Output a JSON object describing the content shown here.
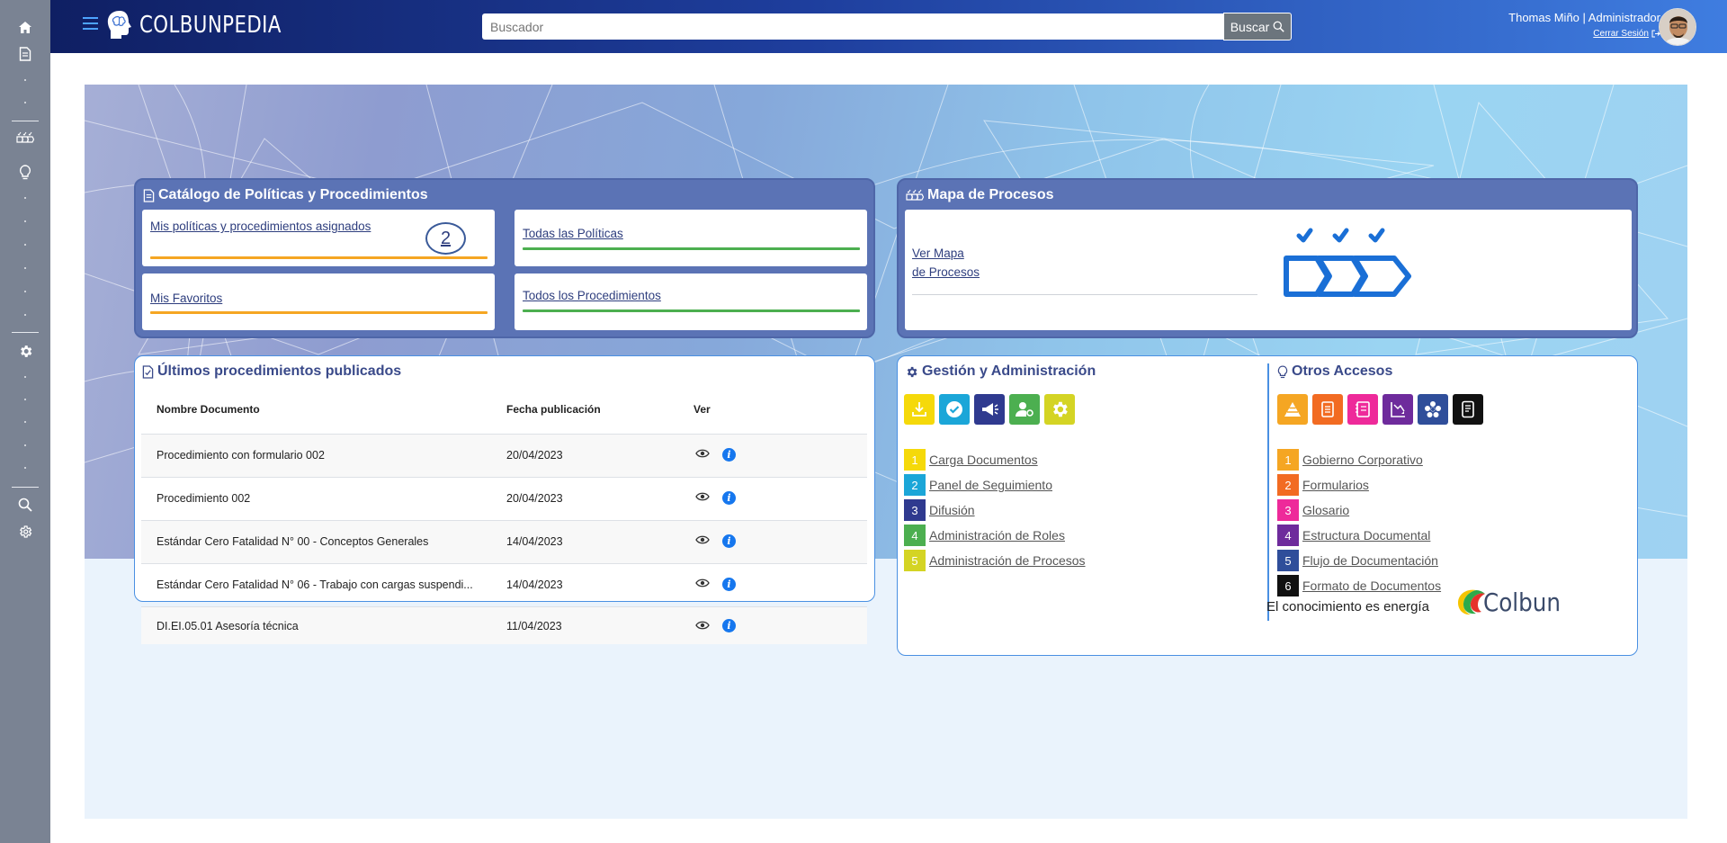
{
  "app": {
    "brand": "COLBUNPEDIA"
  },
  "header": {
    "search_placeholder": "Buscador",
    "search_button": "Buscar",
    "user_name": "Thomas Miño | Administrador",
    "logout_label": "Cerrar Sesión"
  },
  "catalog": {
    "title": "Catálogo de Políticas y Procedimientos",
    "assigned_label": "Mis políticas y procedimientos asignados",
    "assigned_count": "2",
    "favorites_label": "Mis Favoritos",
    "all_policies_label": "Todas las Políticas",
    "all_procedures_label": "Todos los Procedimientos"
  },
  "process_map": {
    "title": "Mapa de Procesos",
    "link_line1": "Ver Mapa",
    "link_line2": "de Procesos"
  },
  "latest": {
    "title": "Últimos procedimientos publicados",
    "columns": [
      "Nombre Documento",
      "Fecha publicación",
      "Ver"
    ],
    "rows": [
      {
        "name": "Procedimiento con formulario 002",
        "date": "20/04/2023"
      },
      {
        "name": "Procedimiento 002",
        "date": "20/04/2023"
      },
      {
        "name": "Estándar Cero Fatalidad N° 00 - Conceptos Generales",
        "date": "14/04/2023"
      },
      {
        "name": "Estándar Cero Fatalidad N° 06 - Trabajo con cargas suspendi...",
        "date": "14/04/2023"
      },
      {
        "name": "DI.EI.05.01 Asesoría técnica",
        "date": "11/04/2023"
      }
    ]
  },
  "management": {
    "title": "Gestión y Administración",
    "tiles": [
      {
        "icon": "download-icon",
        "color": "#f5d90a"
      },
      {
        "icon": "check-circle-icon",
        "color": "#1ba6d8"
      },
      {
        "icon": "megaphone-icon",
        "color": "#2f3a8f"
      },
      {
        "icon": "user-gear-icon",
        "color": "#4caf50"
      },
      {
        "icon": "gear-icon",
        "color": "#d4d424"
      }
    ],
    "items": [
      {
        "num": "1",
        "label": "Carga Documentos",
        "color": "#f5d90a"
      },
      {
        "num": "2",
        "label": "Panel de Seguimiento",
        "color": "#1ba6d8"
      },
      {
        "num": "3",
        "label": "Difusión",
        "color": "#2f3a8f"
      },
      {
        "num": "4",
        "label": "Administración de Roles",
        "color": "#4caf50"
      },
      {
        "num": "5",
        "label": "Administración de Procesos",
        "color": "#d4d424"
      }
    ]
  },
  "other": {
    "title": "Otros Accesos",
    "tiles": [
      {
        "icon": "pyramid-icon",
        "color": "#f5a623"
      },
      {
        "icon": "form-icon",
        "color": "#f26b22"
      },
      {
        "icon": "glossary-icon",
        "color": "#ee2a9a"
      },
      {
        "icon": "structure-icon",
        "color": "#6e2b9c"
      },
      {
        "icon": "flow-icon",
        "color": "#2f4e9a"
      },
      {
        "icon": "document-format-icon",
        "color": "#111111"
      }
    ],
    "items": [
      {
        "num": "1",
        "label": "Gobierno Corporativo",
        "color": "#f5a623"
      },
      {
        "num": "2",
        "label": "Formularios",
        "color": "#f26b22"
      },
      {
        "num": "3",
        "label": "Glosario",
        "color": "#ee2a9a"
      },
      {
        "num": "4",
        "label": "Estructura Documental",
        "color": "#6e2b9c"
      },
      {
        "num": "5",
        "label": "Flujo de Documentación",
        "color": "#2f4e9a"
      },
      {
        "num": "6",
        "label": "Formato de Documentos",
        "color": "#111111"
      }
    ]
  },
  "footer": {
    "tagline": "El conocimiento es energía",
    "logo_text": "Colbun"
  }
}
